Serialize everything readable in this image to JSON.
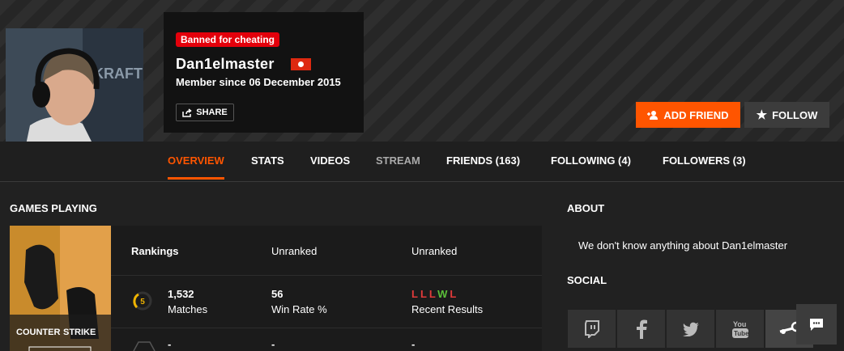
{
  "profile": {
    "ban_badge": "Banned for cheating",
    "username": "Dan1elmaster",
    "member_since": "Member since 06 December 2015",
    "share_label": "SHARE"
  },
  "actions": {
    "add_friend": "ADD FRIEND",
    "follow": "FOLLOW"
  },
  "tabs": [
    {
      "label": "OVERVIEW"
    },
    {
      "label": "STATS"
    },
    {
      "label": "VIDEOS"
    },
    {
      "label": "STREAM"
    },
    {
      "label": "FRIENDS (163)"
    },
    {
      "label": "FOLLOWING (4)"
    },
    {
      "label": "FOLLOWERS (3)"
    }
  ],
  "games": {
    "heading": "GAMES PLAYING",
    "rankings_label": "Rankings",
    "rank1": "Unranked",
    "rank2": "Unranked",
    "level": "5",
    "matches_value": "1,532",
    "matches_label": "Matches",
    "winrate_value": "56",
    "winrate_label": "Win Rate %",
    "results": [
      "L",
      "L",
      "L",
      "W",
      "L"
    ],
    "results_label": "Recent Results",
    "row3": [
      "-",
      "-",
      "-"
    ],
    "cover_text": "COUNTER STRIKE"
  },
  "about": {
    "heading": "ABOUT",
    "text": "We don't know anything about Dan1elmaster"
  },
  "social": {
    "heading": "SOCIAL",
    "icons": [
      "twitch-icon",
      "facebook-icon",
      "twitter-icon",
      "youtube-icon",
      "steam-icon"
    ]
  },
  "colors": {
    "accent": "#ff5500",
    "loss": "#e03a3a",
    "win": "#5bbf3a",
    "ban": "#e3000b"
  }
}
